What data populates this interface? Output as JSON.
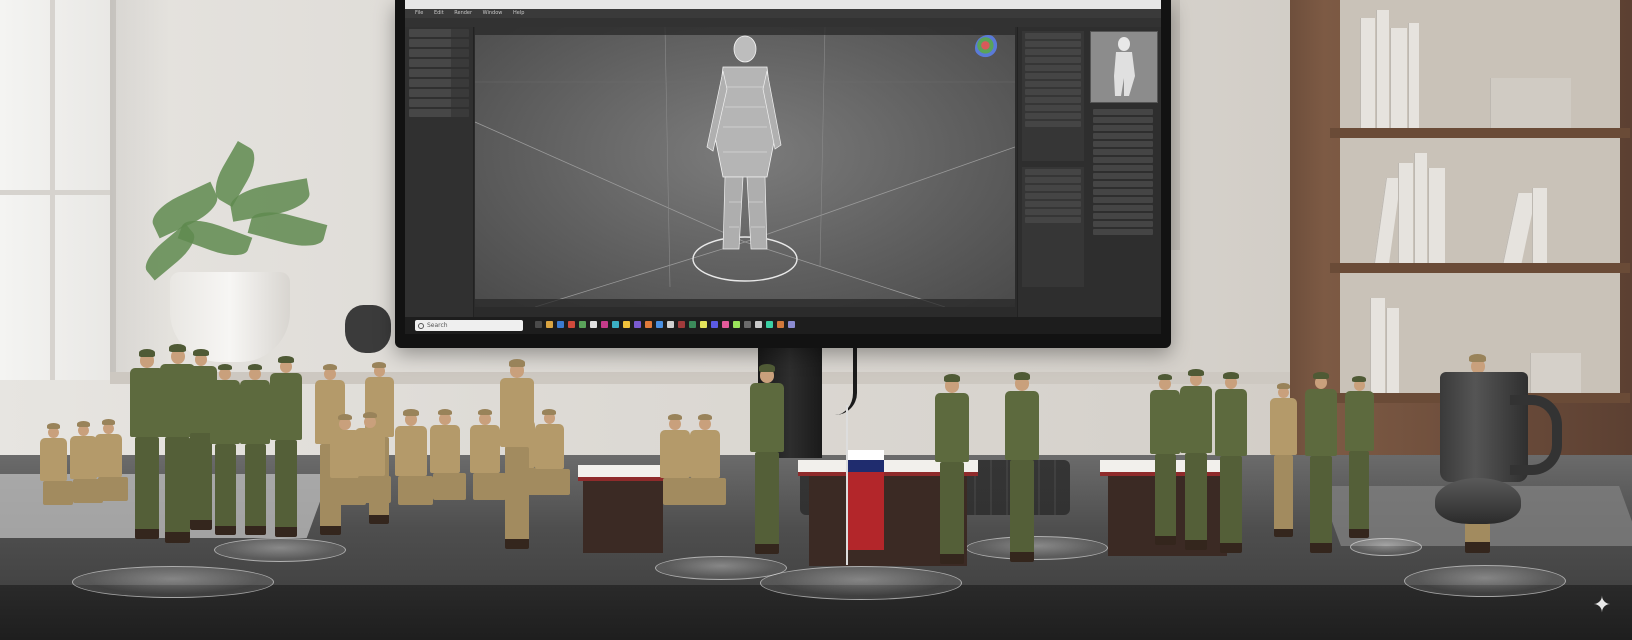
{
  "screen": {
    "window_title": "",
    "menu_items": [
      "File",
      "Edit",
      "Render",
      "Window",
      "Help"
    ],
    "search_placeholder": "Search",
    "clock_time": "",
    "clock_date": ""
  },
  "colors": {
    "desk": "#4e4e4e",
    "khaki_uniform": "#b49a6a",
    "olive_uniform": "#5d6a3e",
    "flag_red": "#b3262a",
    "flag_blue": "#1f2c6e"
  },
  "icons": {
    "search": "search-icon",
    "gizmo": "navigation-gizmo-icon",
    "sparkle": "sparkle-icon"
  }
}
